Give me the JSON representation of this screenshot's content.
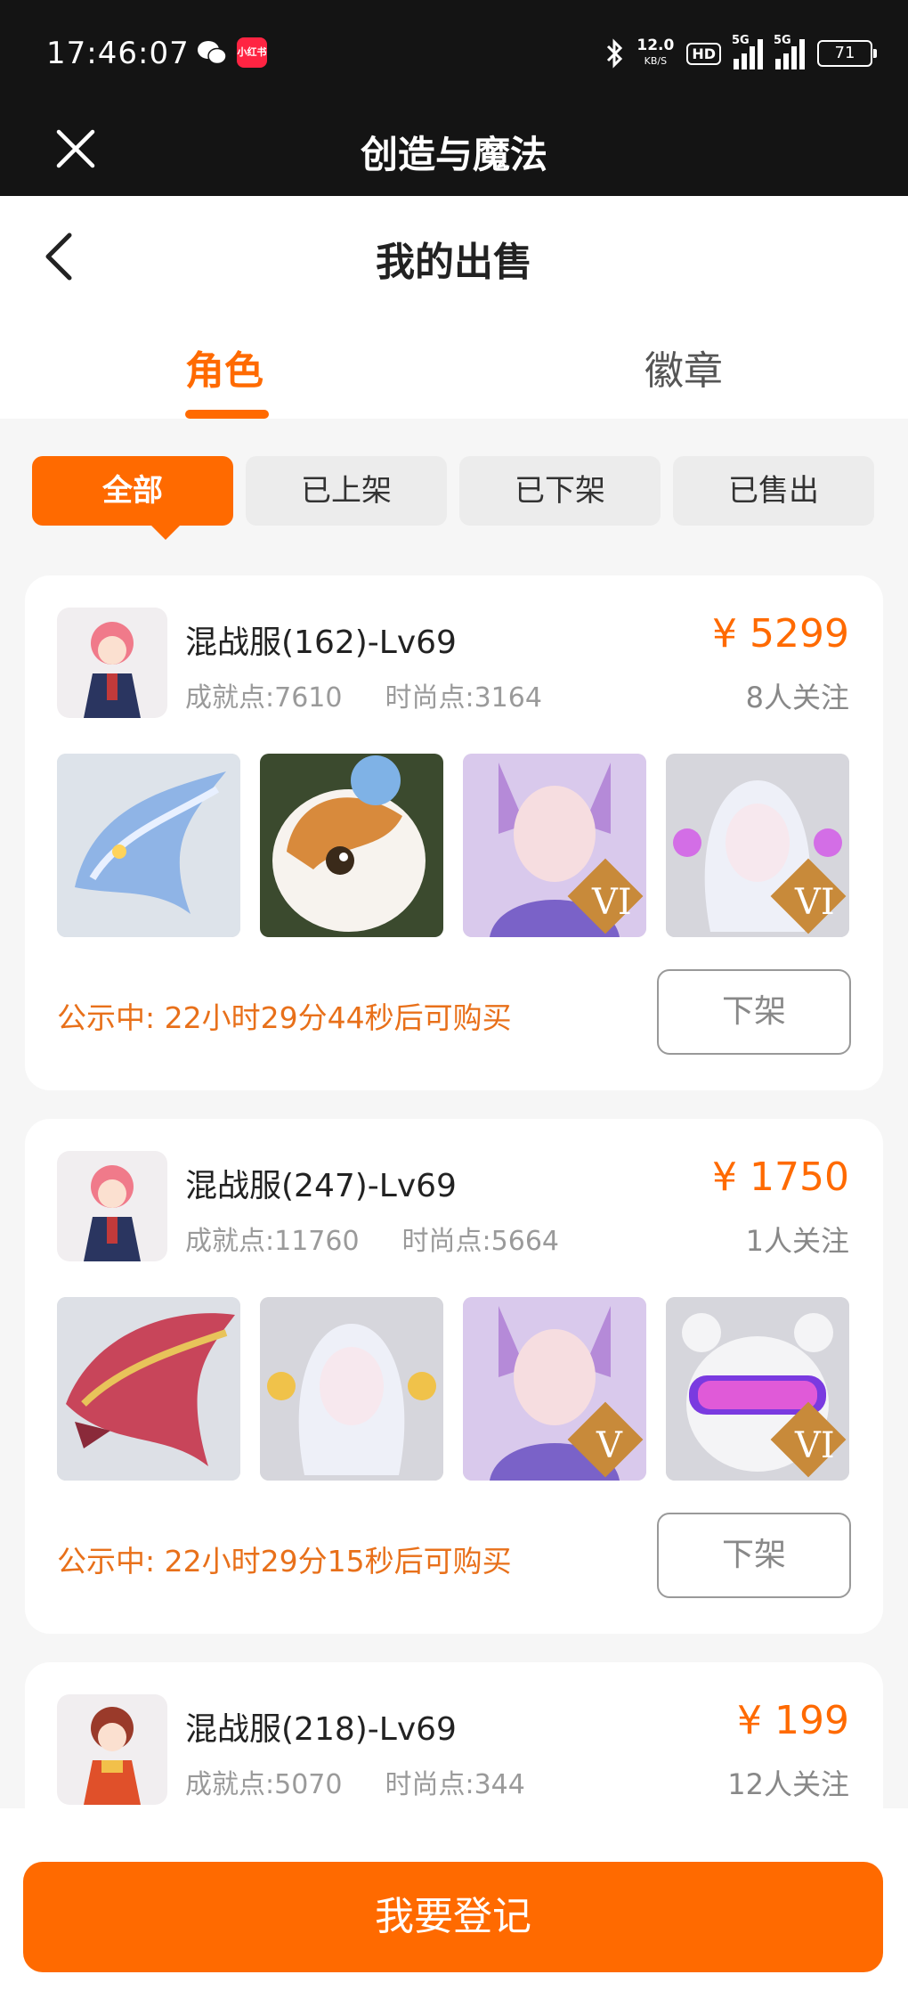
{
  "status_bar": {
    "time": "17:46:07",
    "app_badge": "小红书",
    "speed_value": "12.0",
    "speed_unit": "KB/S",
    "hd": "HD",
    "signal1_label": "5G",
    "signal2_label": "5G",
    "battery": "71"
  },
  "title_bar": {
    "title": "创造与魔法"
  },
  "header": {
    "title": "我的出售"
  },
  "tabs": [
    {
      "label": "角色",
      "active": true
    },
    {
      "label": "徽章",
      "active": false
    }
  ],
  "filters": [
    {
      "label": "全部",
      "active": true
    },
    {
      "label": "已上架",
      "active": false
    },
    {
      "label": "已下架",
      "active": false
    },
    {
      "label": "已售出",
      "active": false
    }
  ],
  "listings": [
    {
      "name": "混战服(162)-Lv69",
      "achievement": "成就点:7610",
      "fashion": "时尚点:3164",
      "price": "¥ 5299",
      "followers": "8人关注",
      "notice": "公示中:  22小时29分44秒后可购买",
      "action": "下架",
      "thumbs": [
        "blue-dragon",
        "calico-cat",
        "fox-girl",
        "white-hair-girl"
      ]
    },
    {
      "name": "混战服(247)-Lv69",
      "achievement": "成就点:11760",
      "fashion": "时尚点:5664",
      "price": "¥ 1750",
      "followers": "1人关注",
      "notice": "公示中:  22小时29分15秒后可购买",
      "action": "下架",
      "thumbs": [
        "red-dragon",
        "white-hair-girl",
        "fox-girl",
        "bear-goggles"
      ]
    },
    {
      "name": "混战服(218)-Lv69",
      "achievement": "成就点:5070",
      "fashion": "时尚点:344",
      "price": "¥ 199",
      "followers": "12人关注"
    }
  ],
  "bottom_button": "我要登记",
  "colors": {
    "accent": "#ff6a00",
    "notice": "#e8701a",
    "dark_bar": "#141414"
  }
}
